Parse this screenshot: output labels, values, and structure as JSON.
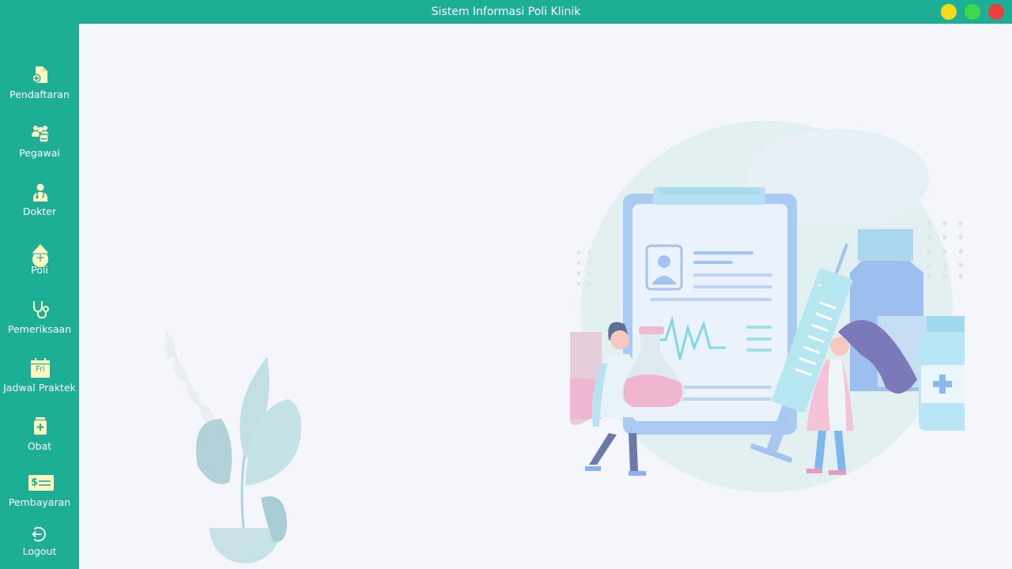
{
  "window": {
    "title": "Sistem Informasi Poli Klinik",
    "controls": [
      "minimize",
      "maximize",
      "close"
    ]
  },
  "colors": {
    "accent": "#1dae96",
    "icon_fill": "#fff7c2",
    "background": "#f4f6fb",
    "minimize": "#f4d91b",
    "maximize": "#3fd84a",
    "close": "#f03e3e"
  },
  "sidebar": {
    "items": [
      {
        "label": "Pendaftaran",
        "icon": "add-document-icon"
      },
      {
        "label": "Pegawai",
        "icon": "staff-group-icon"
      },
      {
        "label": "Dokter",
        "icon": "doctor-icon"
      },
      {
        "label": "Poli",
        "icon": "poli-icon"
      },
      {
        "label": "Pemeriksaan",
        "icon": "stethoscope-icon"
      },
      {
        "label": "Jadwal Praktek",
        "icon": "calendar-icon",
        "icon_text": "Fri"
      },
      {
        "label": "Obat",
        "icon": "medicine-bottle-icon"
      },
      {
        "label": "Pembayaran",
        "icon": "payment-bill-icon",
        "icon_text": "$"
      },
      {
        "label": "Logout",
        "icon": "logout-icon"
      }
    ]
  },
  "main": {
    "illustration": "clinic-medical-illustration"
  }
}
